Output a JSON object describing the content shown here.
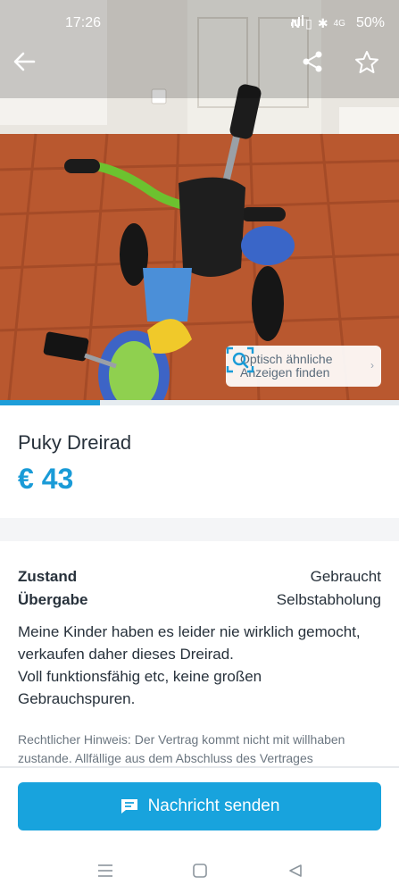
{
  "status_bar": {
    "time": "17:26",
    "nfc": "N",
    "vibrate": "▯",
    "bluetooth": "✱",
    "network": "4G",
    "battery": "50%"
  },
  "colors": {
    "accent": "#1a9bd7",
    "button": "#18a3dd",
    "text": "#27313b",
    "muted": "#6b7680"
  },
  "hero": {
    "visual_search_label": "Optisch ähnliche Anzeigen finden",
    "visual_search_line1": "Optisch ähnliche",
    "visual_search_line2": "Anzeigen finden",
    "gallery_progress": 0.25,
    "icons": [
      "back-arrow-icon",
      "share-icon",
      "star-icon",
      "visual-search-icon"
    ]
  },
  "listing": {
    "title": "Puky Dreirad",
    "price": "€ 43"
  },
  "attributes": [
    {
      "label": "Zustand",
      "value": "Gebraucht"
    },
    {
      "label": "Übergabe",
      "value": "Selbstabholung"
    }
  ],
  "description": {
    "line1": "Meine Kinder haben es leider nie wirklich gemocht,",
    "line2": "verkaufen daher dieses Dreirad.",
    "line3": "Voll funktionsfähig etc, keine großen",
    "line4": "Gebrauchspuren."
  },
  "legal": {
    "text": "Rechtlicher Hinweis: Der Vertrag kommt nicht mit willhaben zustande. Allfällige aus dem Abschluss des Vertrages"
  },
  "cta": {
    "send_label": "Nachricht senden"
  },
  "navigation": {
    "items": [
      "menu-icon",
      "home-icon",
      "back-icon"
    ]
  }
}
